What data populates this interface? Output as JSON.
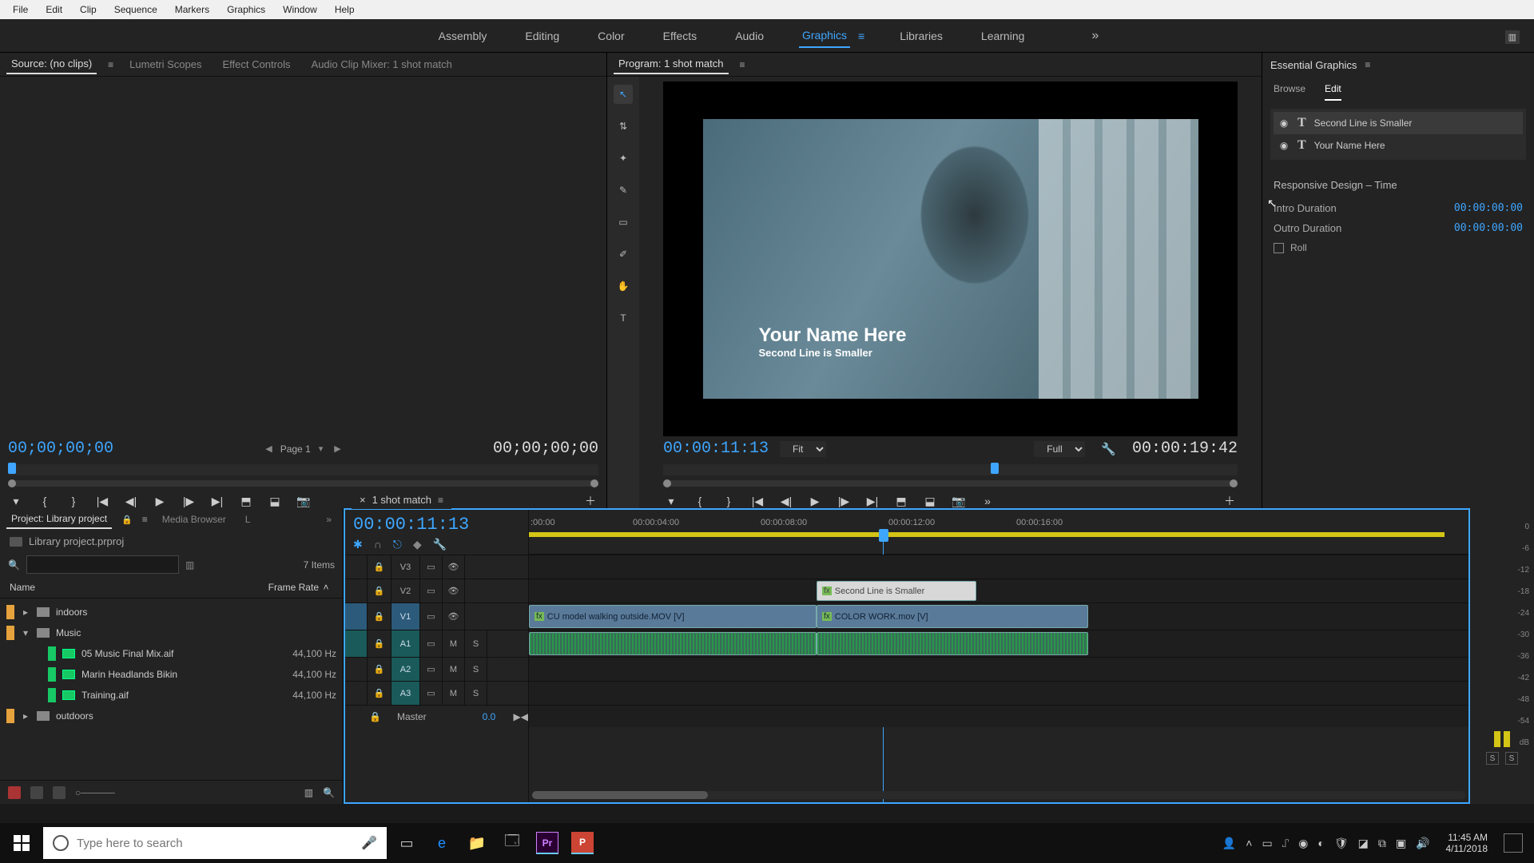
{
  "menu": [
    "File",
    "Edit",
    "Clip",
    "Sequence",
    "Markers",
    "Graphics",
    "Window",
    "Help"
  ],
  "workspaces": {
    "items": [
      "Assembly",
      "Editing",
      "Color",
      "Effects",
      "Audio",
      "Graphics",
      "Libraries",
      "Learning"
    ],
    "active": "Graphics"
  },
  "source_panel": {
    "tabs": [
      "Source: (no clips)",
      "Lumetri Scopes",
      "Effect Controls",
      "Audio Clip Mixer: 1 shot match"
    ],
    "active": "Source: (no clips)",
    "tc_in": "00;00;00;00",
    "tc_out": "00;00;00;00",
    "page_label": "Page 1"
  },
  "program_panel": {
    "tab": "Program: 1 shot match",
    "tc_in": "00:00:11:13",
    "tc_out": "00:00:19:42",
    "fit": "Fit",
    "quality": "Full",
    "overlay_title": "Your Name Here",
    "overlay_sub": "Second Line is Smaller",
    "tools": [
      "selection",
      "text-vert",
      "snap",
      "pen",
      "rect",
      "eyedrop",
      "hand",
      "type"
    ]
  },
  "essential_graphics": {
    "title": "Essential Graphics",
    "tabs": [
      "Browse",
      "Edit"
    ],
    "active": "Edit",
    "layers": [
      {
        "name": "Second Line is Smaller",
        "selected": true
      },
      {
        "name": "Your Name Here",
        "selected": false
      }
    ],
    "responsive_title": "Responsive Design – Time",
    "intro_label": "Intro Duration",
    "intro_val": "00:00:00:00",
    "outro_label": "Outro Duration",
    "outro_val": "00:00:00:00",
    "roll_label": "Roll"
  },
  "project_panel": {
    "tabs": [
      "Project: Library project",
      "Media Browser",
      "L"
    ],
    "active": "Project: Library project",
    "proj_name": "Library project.prproj",
    "items_count": "7 Items",
    "columns": [
      "Name",
      "Frame Rate"
    ],
    "tree": [
      {
        "type": "folder",
        "name": "indoors",
        "swatch": "orange",
        "expand": "closed"
      },
      {
        "type": "folder",
        "name": "Music",
        "swatch": "orange",
        "expand": "open",
        "children": [
          {
            "type": "audio",
            "name": "05 Music Final Mix.aif",
            "rate": "44,100 Hz"
          },
          {
            "type": "audio",
            "name": "Marin Headlands Bikin",
            "rate": "44,100 Hz"
          },
          {
            "type": "audio",
            "name": "Training.aif",
            "rate": "44,100 Hz"
          }
        ]
      },
      {
        "type": "folder",
        "name": "outdoors",
        "swatch": "orange",
        "expand": "closed"
      }
    ]
  },
  "timeline": {
    "name": "1 shot match",
    "tc": "00:00:11:13",
    "ticks": [
      ":00:00",
      "00:00:04:00",
      "00:00:08:00",
      "00:00:12:00",
      "00:00:16:00"
    ],
    "tracks_v": [
      "V3",
      "V2",
      "V1"
    ],
    "tracks_a": [
      "A1",
      "A2",
      "A3"
    ],
    "master_label": "Master",
    "master_db": "0.0",
    "clips": {
      "v2_gfx": "Second Line is Smaller",
      "v1_a": "CU model walking outside.MOV [V]",
      "v1_b": "COLOR WORK.mov [V]"
    },
    "playhead_pct": 48
  },
  "meters": {
    "scale": [
      "0",
      "-6",
      "-12",
      "-18",
      "-24",
      "-30",
      "-36",
      "-42",
      "-48",
      "-54",
      "dB"
    ],
    "solo": "S"
  },
  "taskbar": {
    "search_placeholder": "Type here to search",
    "time": "11:45 AM",
    "date": "4/11/2018"
  }
}
